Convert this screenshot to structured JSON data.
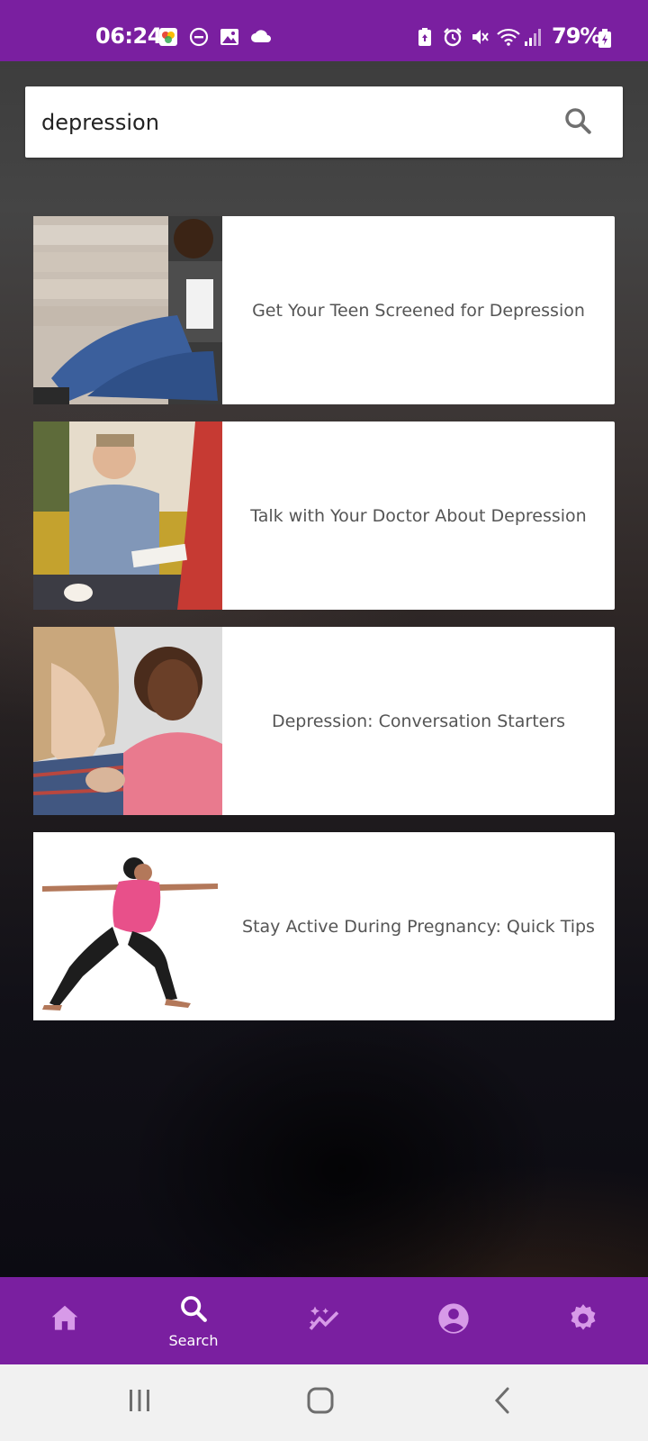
{
  "status_bar": {
    "time": "06:24",
    "battery": "79%",
    "left_icons": [
      "photos-icon",
      "do-not-disturb-icon",
      "gallery-icon",
      "cloud-icon"
    ],
    "right_icons": [
      "battery-saver-icon",
      "alarm-icon",
      "mute-icon",
      "wifi-icon",
      "signal-icon",
      "battery-charging-icon"
    ]
  },
  "search": {
    "value": "depression",
    "icon": "search-icon"
  },
  "results": [
    {
      "title": "Get Your Teen Screened for Depression",
      "image": "teen-sitting-on-steps-photo"
    },
    {
      "title": "Talk with Your Doctor About Depression",
      "image": "doctor-consultation-photo"
    },
    {
      "title": "Depression: Conversation Starters",
      "image": "women-talking-photo"
    },
    {
      "title": "Stay Active During Pregnancy: Quick Tips",
      "image": "pregnant-woman-yoga-photo"
    }
  ],
  "bottom_nav": {
    "items": [
      {
        "icon": "home-icon",
        "label": ""
      },
      {
        "icon": "search-icon",
        "label": "Search",
        "active": true
      },
      {
        "icon": "insights-icon",
        "label": ""
      },
      {
        "icon": "account-icon",
        "label": ""
      },
      {
        "icon": "settings-icon",
        "label": ""
      }
    ]
  },
  "colors": {
    "brand_purple": "#7a1fa0",
    "inactive_icon": "#d79ae8",
    "card_text": "#555555"
  },
  "system_nav": [
    "recent-apps-icon",
    "home-button-icon",
    "back-icon"
  ]
}
